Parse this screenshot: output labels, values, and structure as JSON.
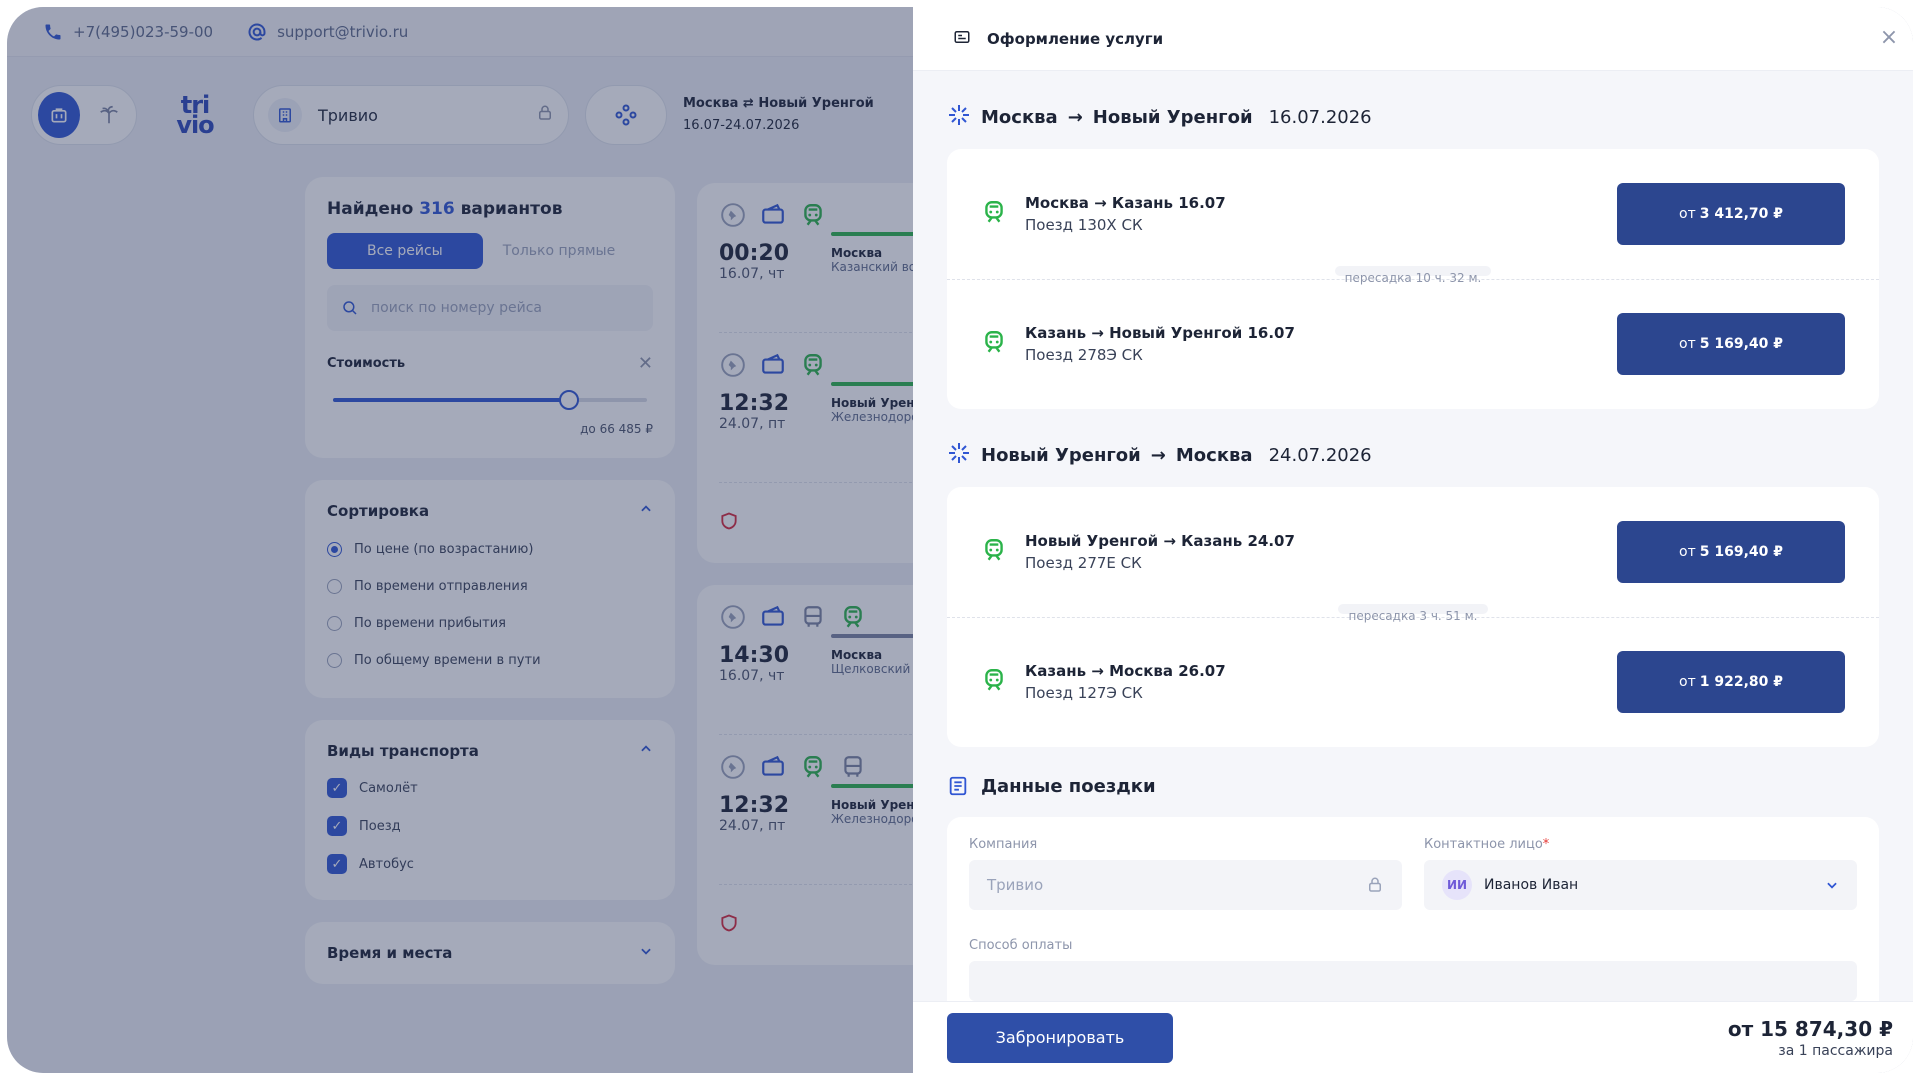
{
  "topbar": {
    "phone": "+7(495)023-59-00",
    "email": "support@trivio.ru"
  },
  "header": {
    "logo_line1": "tri",
    "logo_line2": "vio",
    "company": "Тривио",
    "route": "Москва ⇄ Новый Уренгой",
    "dates": "16.07-24.07.2026"
  },
  "sidebar": {
    "found_prefix": "Найдено",
    "found_count": "316",
    "found_suffix": "вариантов",
    "tab_all": "Все рейсы",
    "tab_direct": "Только прямые",
    "search_placeholder": "поиск по номеру рейса",
    "price_label": "Стоимость",
    "price_slider_fraction": 0.75,
    "price_upto": "до 66 485 ₽",
    "sort_title": "Сортировка",
    "sort_options": [
      {
        "label": "По цене (по возрастанию)",
        "selected": true
      },
      {
        "label": "По времени отправления",
        "selected": false
      },
      {
        "label": "По времени прибытия",
        "selected": false
      },
      {
        "label": "По общему времени в пути",
        "selected": false
      }
    ],
    "transport_title": "Виды транспорта",
    "transport_options": [
      "Самолёт",
      "Поезд",
      "Автобус"
    ],
    "time_title": "Время и места"
  },
  "results": [
    {
      "time": "00:20",
      "date": "16.07, чт",
      "city": "Москва",
      "station": "Казанский вок"
    },
    {
      "time": "12:32",
      "date": "24.07, пт",
      "city": "Новый Уренго",
      "station": "Железнодорож"
    },
    {
      "time": "14:30",
      "date": "16.07, чт",
      "city": "Москва",
      "station": "Щелковский (Ц"
    },
    {
      "time": "12:32",
      "date": "24.07, пт",
      "city": "Новый Уренго",
      "station": "Железнодорож"
    }
  ],
  "modal": {
    "title": "Оформление услуги",
    "legs": [
      {
        "from": "Москва",
        "to": "Новый Уренгой",
        "date": "16.07.2026",
        "segments": [
          {
            "title": "Москва → Казань 16.07",
            "train": "Поезд 130Х СК",
            "price_prefix": "от",
            "price": "3 412,70 ₽"
          },
          {
            "title": "Казань → Новый Уренгой 16.07",
            "train": "Поезд 278Э СК",
            "price_prefix": "от",
            "price": "5 169,40 ₽"
          }
        ],
        "transfer": "пересадка 10 ч. 32 м."
      },
      {
        "from": "Новый Уренгой",
        "to": "Москва",
        "date": "24.07.2026",
        "segments": [
          {
            "title": "Новый Уренгой → Казань 24.07",
            "train": "Поезд 277Е СК",
            "price_prefix": "от",
            "price": "5 169,40 ₽"
          },
          {
            "title": "Казань → Москва 26.07",
            "train": "Поезд 127Э СК",
            "price_prefix": "от",
            "price": "1 922,80 ₽"
          }
        ],
        "transfer": "пересадка 3 ч. 51 м."
      }
    ],
    "trip_data_title": "Данные поездки",
    "company_label": "Компания",
    "company_value": "Тривио",
    "contact_label": "Контактное лицо",
    "contact_required": "*",
    "contact_initials": "ИИ",
    "contact_name": "Иванов Иван",
    "payment_label": "Способ оплаты",
    "book_button": "Забронировать",
    "total": "от 15 874,30 ₽",
    "per_passenger": "за 1 пассажира"
  },
  "colors": {
    "accent": "#3056d3",
    "price_button": "#2c468f",
    "train_green": "#2bb34a"
  }
}
